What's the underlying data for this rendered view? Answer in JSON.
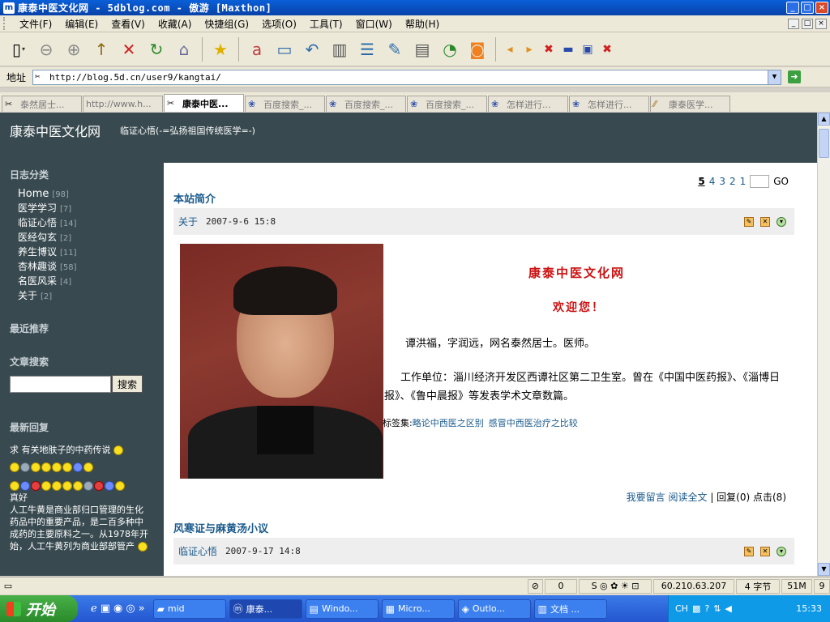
{
  "window": {
    "title": "康泰中医文化网 - 5dblog.com - 傲游 [Maxthon]",
    "controls": [
      "_",
      "□",
      "×"
    ]
  },
  "menu": [
    "文件(F)",
    "编辑(E)",
    "查看(V)",
    "收藏(A)",
    "快捷组(G)",
    "选项(O)",
    "工具(T)",
    "窗口(W)",
    "帮助(H)"
  ],
  "toolbar": {
    "icons": [
      "new-page-icon",
      "back-icon",
      "forward-icon",
      "up-icon",
      "stop-icon",
      "refresh-icon",
      "home-icon",
      "favorites-icon",
      "translate-icon",
      "window-icon",
      "undo-icon",
      "columns-icon",
      "list-icon",
      "edit-icon",
      "pen-icon",
      "speed-icon",
      "rss-icon",
      "prev-icon",
      "next-icon",
      "close-tab-icon",
      "minimize-icon",
      "restore-icon",
      "close-icon"
    ]
  },
  "address": {
    "label": "地址",
    "url": "http://blog.5d.cn/user9/kangtai/"
  },
  "tabs": [
    {
      "label": "泰然居士...",
      "active": false
    },
    {
      "label": "http://www.h...",
      "active": false
    },
    {
      "label": "康泰中医...",
      "active": true
    },
    {
      "label": "百度搜索_...",
      "active": false
    },
    {
      "label": "百度搜索_...",
      "active": false
    },
    {
      "label": "百度搜索_...",
      "active": false
    },
    {
      "label": "怎样进行...",
      "active": false
    },
    {
      "label": "怎样进行...",
      "active": false
    },
    {
      "label": "康泰医学...",
      "active": false
    }
  ],
  "site": {
    "title": "康泰中医文化网",
    "subtitle": "临证心悟(-=弘扬祖国传统医学=-)"
  },
  "sidebar": {
    "categories_heading": "日志分类",
    "categories": [
      {
        "name": "Home",
        "count": "[98]"
      },
      {
        "name": "医学学习",
        "count": "[7]"
      },
      {
        "name": "临证心悟",
        "count": "[14]"
      },
      {
        "name": "医经勾玄",
        "count": "[2]"
      },
      {
        "name": "养生博议",
        "count": "[11]"
      },
      {
        "name": "杏林趣谈",
        "count": "[58]"
      },
      {
        "name": "名医风采",
        "count": "[4]"
      },
      {
        "name": "关于",
        "count": "[2]"
      }
    ],
    "recommend_heading": "最近推荐",
    "search_heading": "文章搜索",
    "search_button": "搜索",
    "replies_heading": "最新回复",
    "reply1": "求 有关地肤子的中药传说",
    "reply2": "真好",
    "reply3": "人工牛黄是商业部归口管理的生化药品中的重要产品，是二百多种中成药的主要原料之一。从1978年开始，人工牛黄列为商业部部管产"
  },
  "pager": {
    "current": "5",
    "pages": [
      "4",
      "3",
      "2",
      "1"
    ],
    "go": "GO"
  },
  "post1": {
    "title": "本站简介",
    "category": "关于",
    "date": "2007-9-6 15:8",
    "heading": "康泰中医文化网",
    "welcome": "欢迎您！",
    "bio": "谭洪福，字润远，网名泰然居士。医师。",
    "work": "工作单位：淄川经济开发区西谭社区第二卫生室。曾在《中国中医药报》、《淄博日报》、《鲁中晨报》等发表学术文章数篇。",
    "tags_label": "标签集:",
    "tags": [
      "略论中西医之区别",
      "感冒中西医治疗之比较"
    ],
    "footer_links": [
      "我要留言",
      "阅读全文"
    ],
    "footer_stats": "| 回复(0) 点击(8)"
  },
  "post2": {
    "title": "风寒证与麻黄汤小议",
    "category": "临证心悟",
    "date": "2007-9-17 14:8"
  },
  "status": {
    "count": "0",
    "ip": "60.210.63.207",
    "bytes": "4 字节",
    "mem": "51M",
    "num": "9"
  },
  "taskbar": {
    "start": "开始",
    "items": [
      {
        "label": "mid",
        "icon": "folder-icon"
      },
      {
        "label": "康泰...",
        "icon": "maxthon-icon"
      },
      {
        "label": "Windo...",
        "icon": "window-icon"
      },
      {
        "label": "Micro...",
        "icon": "app-icon"
      },
      {
        "label": "Outlo...",
        "icon": "outlook-icon"
      },
      {
        "label": "文档 ...",
        "icon": "document-icon"
      }
    ],
    "lang": "CH",
    "clock": "15:33"
  }
}
